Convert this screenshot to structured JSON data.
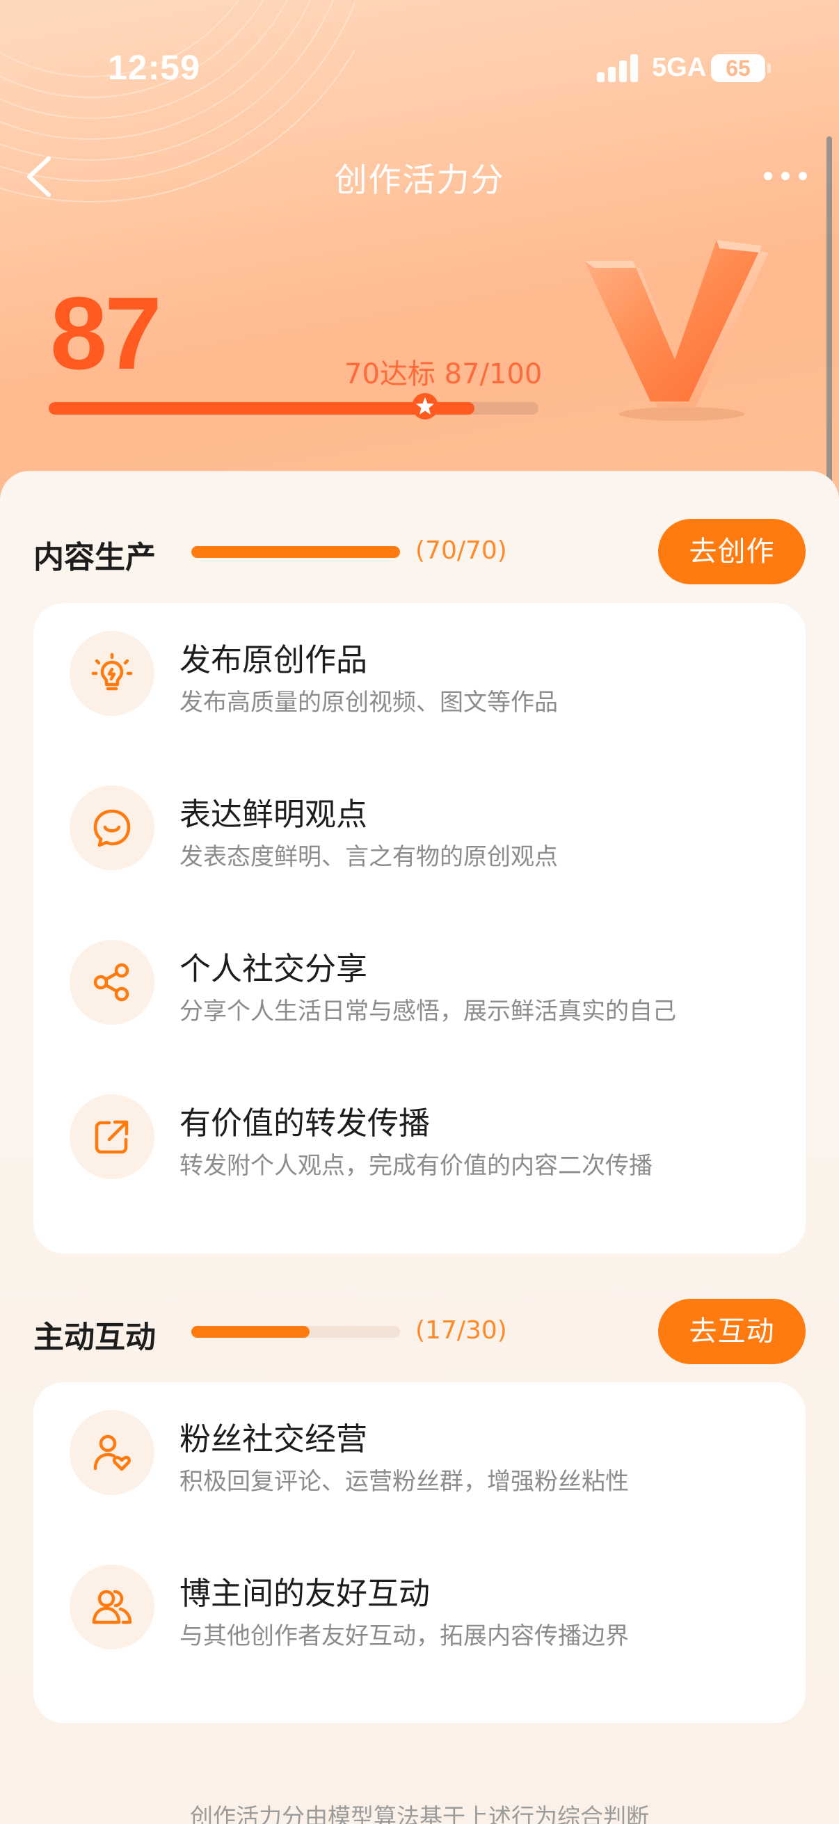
{
  "status_bar": {
    "time": "12:59",
    "network": "5GA",
    "battery": "65"
  },
  "nav": {
    "title": "创作活力分"
  },
  "score": {
    "value": "87",
    "label": "70达标 87/100",
    "progress": 0.87,
    "target": 0.7
  },
  "sections": [
    {
      "title": "内容生产",
      "count": "(70/70)",
      "progress": 1.0,
      "button": "去创作",
      "items": [
        {
          "title": "发布原创作品",
          "desc": "发布高质量的原创视频、图文等作品",
          "icon": "lightbulb-icon"
        },
        {
          "title": "表达鲜明观点",
          "desc": "发表态度鲜明、言之有物的原创观点",
          "icon": "chat-smile-icon"
        },
        {
          "title": "个人社交分享",
          "desc": "分享个人生活日常与感悟，展示鲜活真实的自己",
          "icon": "share-icon"
        },
        {
          "title": "有价值的转发传播",
          "desc": "转发附个人观点，完成有价值的内容二次传播",
          "icon": "forward-icon"
        }
      ]
    },
    {
      "title": "主动互动",
      "count": "(17/30)",
      "progress": 0.567,
      "button": "去互动",
      "items": [
        {
          "title": "粉丝社交经营",
          "desc": "积极回复评论、运营粉丝群，增强粉丝粘性",
          "icon": "user-heart-icon"
        },
        {
          "title": "博主间的友好互动",
          "desc": "与其他创作者友好互动，拓展内容传播边界",
          "icon": "users-icon"
        }
      ]
    }
  ],
  "footer": "创作活力分由模型算法基于上述行为综合判断",
  "colors": {
    "accent": "#ff7a0f",
    "score": "#ff5a1f"
  }
}
